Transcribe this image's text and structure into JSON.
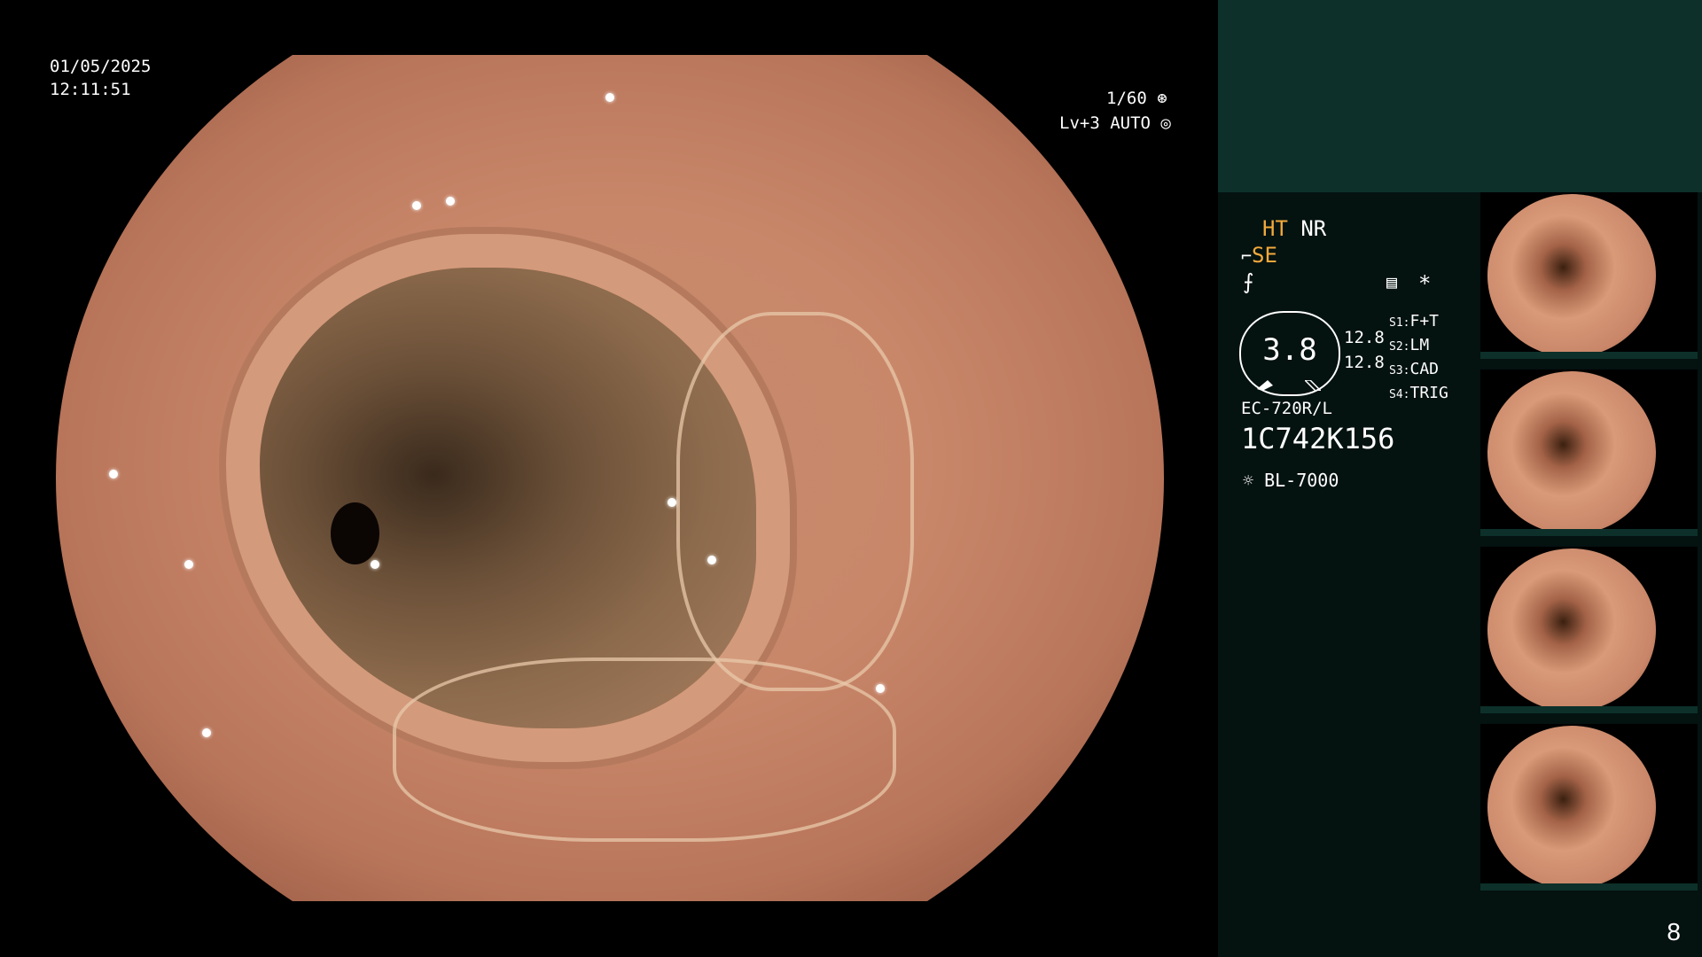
{
  "overlay": {
    "date": "01/05/2025",
    "time": "12:11:51",
    "shutter": "1/60",
    "shutter_icon": "aperture-icon",
    "level": "Lv+3 AUTO",
    "level_icon": "iris-icon"
  },
  "panel": {
    "mode_ht": "HT",
    "mode_nr": "NR",
    "se_label": "SE",
    "se_icon": "tube-icon",
    "freeze_icon": "freeze-icon",
    "memory_icon": "memory-icon",
    "asterisk": "*",
    "gauge_value": "3.8",
    "reading_1": "12.8",
    "reading_2": "12.8",
    "switches": [
      {
        "key": "S1:",
        "value": "F+T"
      },
      {
        "key": "S2:",
        "value": "LM"
      },
      {
        "key": "S3:",
        "value": "CAD"
      },
      {
        "key": "S4:",
        "value": "TRIG"
      }
    ],
    "scope_model": "EC-720R/L",
    "serial": "1C742K156",
    "light_icon": "light-source-icon",
    "light_source": "BL-7000",
    "colors": {
      "orange": "#f2a93b",
      "panel_top": "#0d302a",
      "panel_bg": "#041210"
    }
  },
  "thumbnails": [
    {
      "label": "captured-image-1"
    },
    {
      "label": "captured-image-2"
    },
    {
      "label": "captured-image-3"
    },
    {
      "label": "captured-image-4"
    }
  ],
  "page_number": "8"
}
